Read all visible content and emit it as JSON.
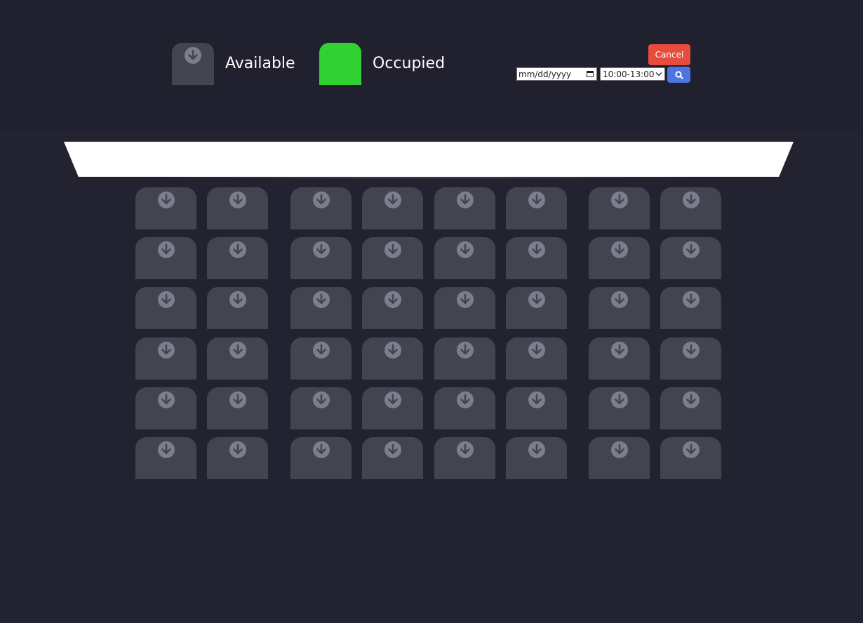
{
  "legend": {
    "available_label": "Available",
    "occupied_label": "Occupied"
  },
  "controls": {
    "cancel_label": "Cancel",
    "date_placeholder": "mm/dd/yyyy",
    "time_value": "10:00-13:00"
  },
  "colors": {
    "available": "#444451",
    "occupied": "#2fd133",
    "cancel": "#e74c3c",
    "search": "#4d74e0",
    "arrow": "#7d7d8e"
  },
  "icons": {
    "seat_icon": "arrow-down-circle-icon",
    "search_icon": "search-icon",
    "calendar_icon": "calendar-icon",
    "select_icon": "chevron-down-icon"
  },
  "seating": {
    "rows": 6,
    "seats_per_row": 8,
    "status": [
      [
        "available",
        "available",
        "available",
        "available",
        "available",
        "available",
        "available",
        "available"
      ],
      [
        "available",
        "available",
        "available",
        "available",
        "available",
        "available",
        "available",
        "available"
      ],
      [
        "available",
        "available",
        "available",
        "available",
        "available",
        "available",
        "available",
        "available"
      ],
      [
        "available",
        "available",
        "available",
        "available",
        "available",
        "available",
        "available",
        "available"
      ],
      [
        "available",
        "available",
        "available",
        "available",
        "available",
        "available",
        "available",
        "available"
      ],
      [
        "available",
        "available",
        "available",
        "available",
        "available",
        "available",
        "available",
        "available"
      ]
    ]
  }
}
